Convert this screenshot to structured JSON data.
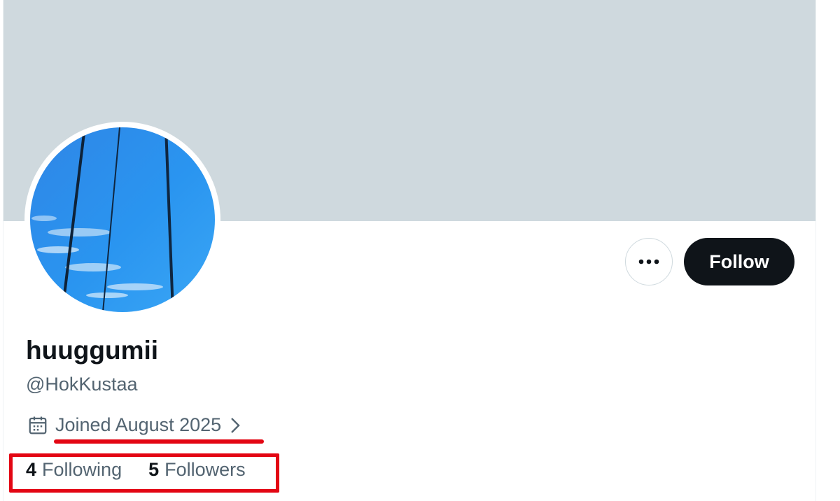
{
  "profile": {
    "display_name": "huuggumii",
    "handle": "@HokKustaa",
    "joined": "Joined August 2025",
    "stats": {
      "following_count": "4",
      "following_label": "Following",
      "followers_count": "5",
      "followers_label": "Followers"
    }
  },
  "actions": {
    "follow_label": "Follow",
    "more_icon": "more-horizontal-icon"
  },
  "icons": {
    "joined": "calendar-icon",
    "joined_chevron": "chevron-right-icon"
  },
  "colors": {
    "banner": "#cfd9de",
    "follow_button_bg": "#0f1419",
    "secondary_text": "#536471",
    "annotation_red": "#e30613"
  }
}
